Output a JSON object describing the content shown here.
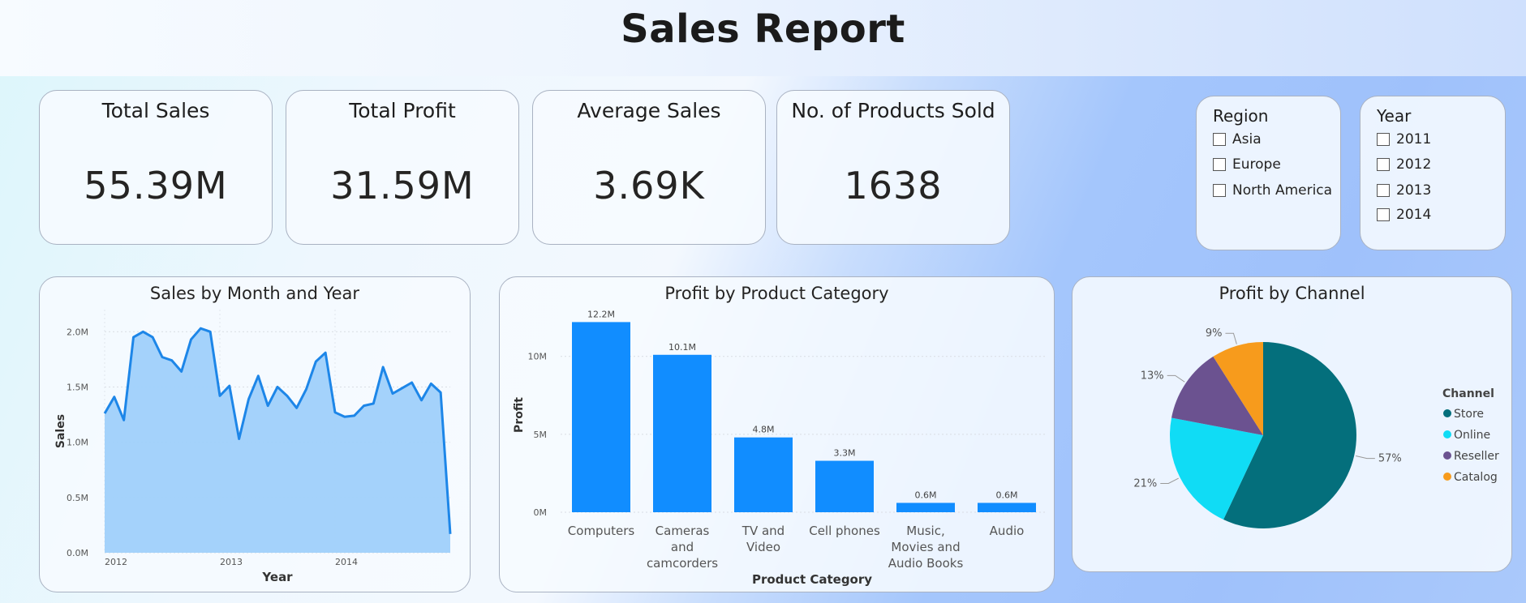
{
  "header": {
    "title": "Sales Report"
  },
  "kpis": [
    {
      "label": "Total Sales",
      "value": "55.39M"
    },
    {
      "label": "Total Profit",
      "value": "31.59M"
    },
    {
      "label": "Average Sales",
      "value": "3.69K"
    },
    {
      "label": "No. of Products Sold",
      "value": "1638"
    }
  ],
  "slicers": {
    "region": {
      "title": "Region",
      "options": [
        "Asia",
        "Europe",
        "North America"
      ]
    },
    "year": {
      "title": "Year",
      "options": [
        "2011",
        "2012",
        "2013",
        "2014"
      ]
    }
  },
  "colors": {
    "line": "#1d86e8",
    "area": "#9fd0fb",
    "bar": "#118dff",
    "store": "#046f7c",
    "online": "#10dcf5",
    "reseller": "#6b5290",
    "catalog": "#f79b1c"
  },
  "chart_data": [
    {
      "type": "area",
      "title": "Sales by Month and Year",
      "xlabel": "Year",
      "ylabel": "Sales",
      "x_tick_labels": [
        "2012",
        "2013",
        "2014"
      ],
      "y_tick_labels": [
        "0.0M",
        "0.5M",
        "1.0M",
        "1.5M",
        "2.0M"
      ],
      "ylim": [
        0,
        2.2
      ],
      "unit": "M",
      "series": [
        {
          "values": [
            1.26,
            1.41,
            1.2,
            1.95,
            2.0,
            1.95,
            1.77,
            1.74,
            1.64,
            1.93,
            2.03,
            2.0,
            1.42,
            1.51,
            1.03,
            1.39,
            1.6,
            1.33,
            1.5,
            1.42,
            1.31,
            1.48,
            1.73,
            1.81,
            1.27,
            1.23,
            1.24,
            1.33,
            1.35,
            1.68,
            1.44,
            1.49,
            1.54,
            1.38,
            1.53,
            1.45,
            0.17
          ]
        }
      ],
      "grid": true
    },
    {
      "type": "bar",
      "title": "Profit by Product Category",
      "xlabel": "Product Category",
      "ylabel": "Profit",
      "categories": [
        [
          "Computers"
        ],
        [
          "Cameras",
          "and",
          "camcorders"
        ],
        [
          "TV and",
          "Video"
        ],
        [
          "Cell phones"
        ],
        [
          "Music,",
          "Movies and",
          "Audio Books"
        ],
        [
          "Audio"
        ]
      ],
      "values": [
        12.2,
        10.1,
        4.8,
        3.3,
        0.6,
        0.6
      ],
      "data_labels": [
        "12.2M",
        "10.1M",
        "4.8M",
        "3.3M",
        "0.6M",
        "0.6M"
      ],
      "y_tick_labels": [
        "0M",
        "5M",
        "10M"
      ],
      "ylim": [
        0,
        13
      ],
      "grid": true
    },
    {
      "type": "pie",
      "title": "Profit by Channel",
      "legend_title": "Channel",
      "legend_position": "right",
      "slices": [
        {
          "name": "Store",
          "value": 57,
          "label": "57%"
        },
        {
          "name": "Online",
          "value": 21,
          "label": "21%"
        },
        {
          "name": "Reseller",
          "value": 13,
          "label": "13%"
        },
        {
          "name": "Catalog",
          "value": 9,
          "label": "9%"
        }
      ]
    }
  ]
}
